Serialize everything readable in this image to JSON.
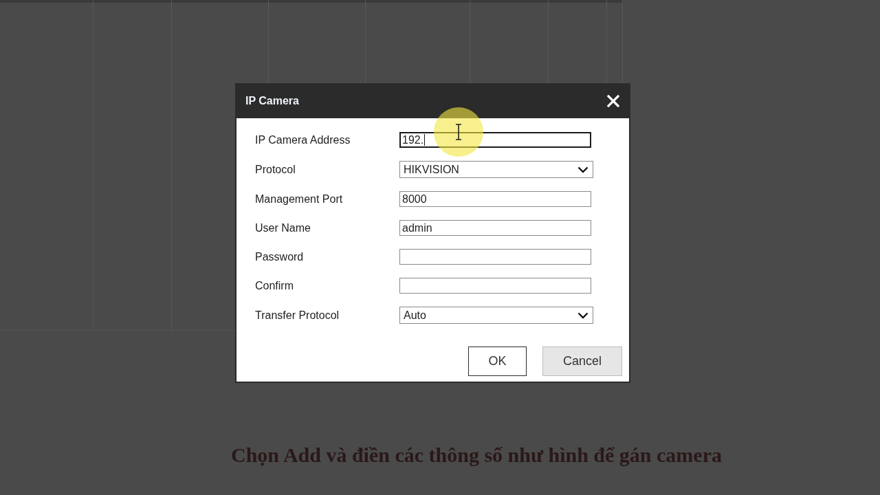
{
  "dialog": {
    "title": "IP Camera",
    "fields": [
      {
        "label": "IP Camera Address",
        "kind": "text",
        "value": "192.",
        "focused": true
      },
      {
        "label": "Protocol",
        "kind": "select",
        "value": "HIKVISION",
        "focused": false
      },
      {
        "label": "Management Port",
        "kind": "text",
        "value": "8000",
        "focused": false
      },
      {
        "label": "User Name",
        "kind": "text",
        "value": "admin",
        "focused": false
      },
      {
        "label": "Password",
        "kind": "text",
        "focused": false
      },
      {
        "label": "Confirm",
        "kind": "text",
        "focused": false
      },
      {
        "label": "Transfer Protocol",
        "kind": "select",
        "value": "Auto",
        "focused": false
      }
    ],
    "buttons": [
      {
        "label": "OK",
        "kind": "default"
      },
      {
        "label": "Cancel",
        "kind": "secondary"
      }
    ]
  },
  "caption": "Chọn Add và điền các thông số như hình để gán camera"
}
